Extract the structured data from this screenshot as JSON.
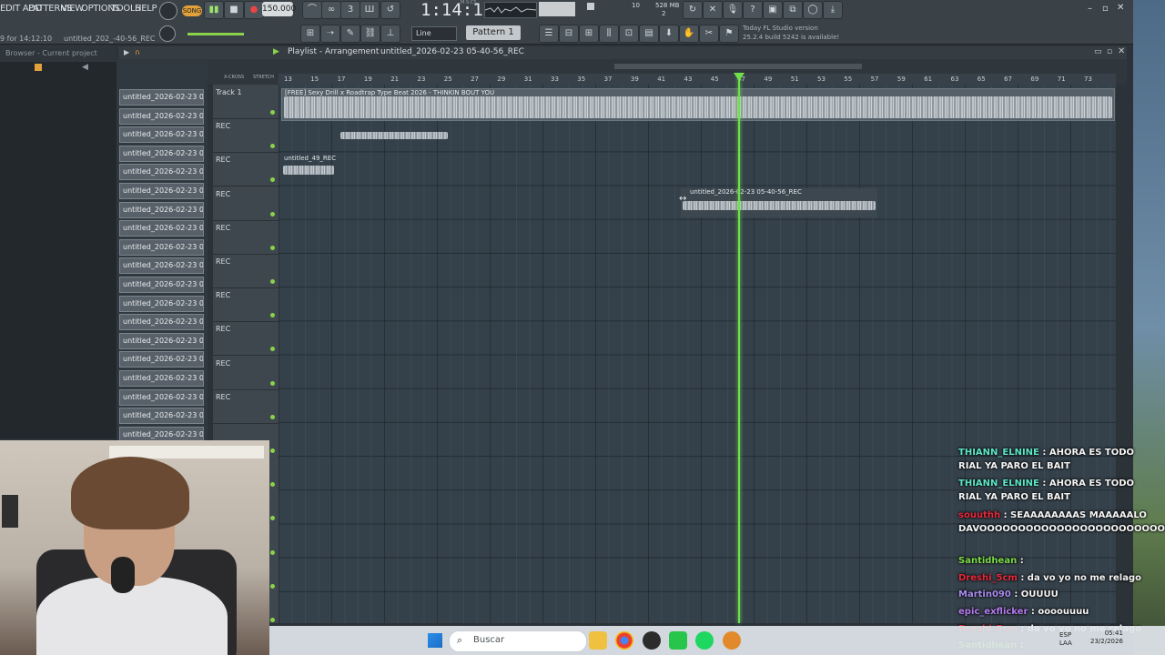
{
  "menu": {
    "items": [
      "EDIT ADD",
      "PATTERNS",
      "VIEW",
      "OPTIONS",
      "TOOLS",
      "HELP"
    ]
  },
  "transport": {
    "mode_label": "SONG",
    "tempo": "150.000",
    "time": "1:14:11",
    "time_unit": "M:S:CS",
    "cpu": "10",
    "ram": "528 MB",
    "poly": "2"
  },
  "toolbar": {
    "snap": "Line",
    "pattern": "Pattern 1",
    "news_line1": "Today  FL Studio version",
    "news_line2": "25.2.4 build 5242 is available!"
  },
  "hint": {
    "left": "9 for 14:12:10",
    "right": "untitled_202_-40-56_REC"
  },
  "browser": {
    "title": "Browser - Current project"
  },
  "playlist": {
    "title": "Playlist - Arrangement",
    "breadcrumb": "untitled_2026-02-23 05-40-56_REC",
    "ruler": [
      "13",
      "15",
      "17",
      "19",
      "21",
      "23",
      "25",
      "27",
      "29",
      "31",
      "33",
      "35",
      "37",
      "39",
      "41",
      "43",
      "45",
      "47",
      "49",
      "51",
      "53",
      "55",
      "57",
      "59",
      "61",
      "63",
      "65",
      "67",
      "69",
      "71",
      "73"
    ],
    "modes": [
      "X-CROSS",
      "STRETCH"
    ]
  },
  "patterns": [
    "untitled_2026-02-23 05-",
    "untitled_2026-02-23 05-",
    "untitled_2026-02-23 05-",
    "untitled_2026-02-23 05-",
    "untitled_2026-02-23 05-",
    "untitled_2026-02-23 05-",
    "untitled_2026-02-23 05-",
    "untitled_2026-02-23 05-",
    "untitled_2026-02-23 05-",
    "untitled_2026-02-23 05-",
    "untitled_2026-02-23 05-",
    "untitled_2026-02-23 05-",
    "untitled_2026-02-23 05-",
    "untitled_2026-02-23 05-",
    "untitled_2026-02-23 05-",
    "untitled_2026-02-23 05-",
    "untitled_2026-02-23 05-",
    "untitled_2026-02-23 05-",
    "untitled_2026-02-23 05-",
    "untitled_2026-02-23 05-"
  ],
  "tracks": [
    "Track 1",
    "REC",
    "REC",
    "REC",
    "REC",
    "REC",
    "REC",
    "REC",
    "REC",
    "REC"
  ],
  "clips": {
    "beat": "[FREE] Sexy Drill x Roadtrap Type Beat 2026 - THINKIN BOUT YOU",
    "rec49": "untitled_49_REC",
    "rec_main": "untitled_2026-02-23 05-40-56_REC"
  },
  "chat": [
    {
      "user": "THIANN_ELNINE",
      "color": "#5ee6c8",
      "msg": ": AHORA ES TODO RIAL YA PARO EL BAIT"
    },
    {
      "user": "THIANN_ELNINE",
      "color": "#5ee6c8",
      "msg": ": AHORA ES TODO RIAL YA PARO EL BAIT"
    },
    {
      "user": "souuthh",
      "color": "#e8283c",
      "msg": ": SEAAAAAAAAS MAAAAALO DAVOOOOOOOOOOOOOOOOOOOOOOOOOOOOOOO"
    },
    {
      "user": "Santidhean",
      "color": "#7ddc4a",
      "msg": ":"
    },
    {
      "user": "Dreshi_5cm",
      "color": "#e8283c",
      "msg": ": da vo yo no me relago"
    },
    {
      "user": "Martin090",
      "color": "#a98cf0",
      "msg": ": OUUUU"
    },
    {
      "user": "epic_exflicker",
      "color": "#b57cf0",
      "msg": ": oooouuuu"
    },
    {
      "user": "Dreshi_5cm",
      "color": "#e8283c",
      "msg": ": da vo yo no me relago"
    },
    {
      "user": "Santidhean",
      "color": "#7ddc4a",
      "msg": ":"
    }
  ],
  "taskbar": {
    "search_placeholder": "Buscar",
    "lang1": "ESP",
    "lang2": "LAA",
    "time": "05:41",
    "date": "23/2/2026"
  }
}
